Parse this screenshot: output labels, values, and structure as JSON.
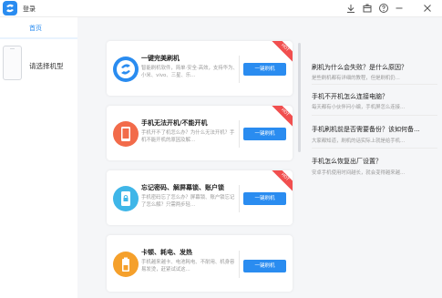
{
  "titlebar": {
    "title": "登录",
    "icons": [
      "download-icon",
      "box-icon",
      "help-icon",
      "minimize-icon",
      "close-icon"
    ]
  },
  "left_panel": {
    "tab_home": "首页",
    "choose_model": "请选择机型"
  },
  "cards": [
    {
      "title": "一键完美刷机",
      "desc": "智能刷机软件，简单·安全·高效，支持华为、小米、vivo、三星、乐...",
      "button": "一键刷机",
      "icon": "flash-logo-icon",
      "icon_color": "#2a8cf0",
      "hot": true
    },
    {
      "title": "手机无法开机/不能开机",
      "desc": "手机开不了机怎么办？为什么无法开机？手机不能开机的原因及解...",
      "button": "一键刷机",
      "icon": "phone-icon",
      "icon_color": "#f26b4a",
      "hot": true
    },
    {
      "title": "忘记密码、解屏幕锁、账户锁",
      "desc": "手机密码忘了怎么办？屏幕锁、账户锁忘记了怎么解？只需两步轻...",
      "button": "一键刷机",
      "icon": "lock-phone-icon",
      "icon_color": "#3fb6e8",
      "hot": true
    },
    {
      "title": "卡顿、耗电、发热",
      "desc": "手机越来越卡、电池耗电、不耐用、机身容易发烫，赶紧试试这...",
      "button": "一键刷机",
      "icon": "battery-icon",
      "icon_color": "#f5a02b",
      "hot": true
    }
  ],
  "hot_label": "HOT",
  "questions": [
    {
      "title": "刷机为什么会失败？是什么原因？",
      "desc": "是些刷机都有详细的教程，但是刷机仍..."
    },
    {
      "title": "手机不开机怎么连接电脑？",
      "desc": "每天都有小伙伴问小编，手机屏怎么连接..."
    },
    {
      "title": "手机刷机前是否需要备份？该如何备...",
      "desc": "大家都知道，刷机的话实际上就是给手机..."
    },
    {
      "title": "手机怎么恢复出厂设置？",
      "desc": "安卓手机使用时间越长，就会变得越来越..."
    }
  ],
  "colors": {
    "accent": "#2a8cf0",
    "hot": "#f14f4f",
    "background": "#f5f6f8"
  }
}
